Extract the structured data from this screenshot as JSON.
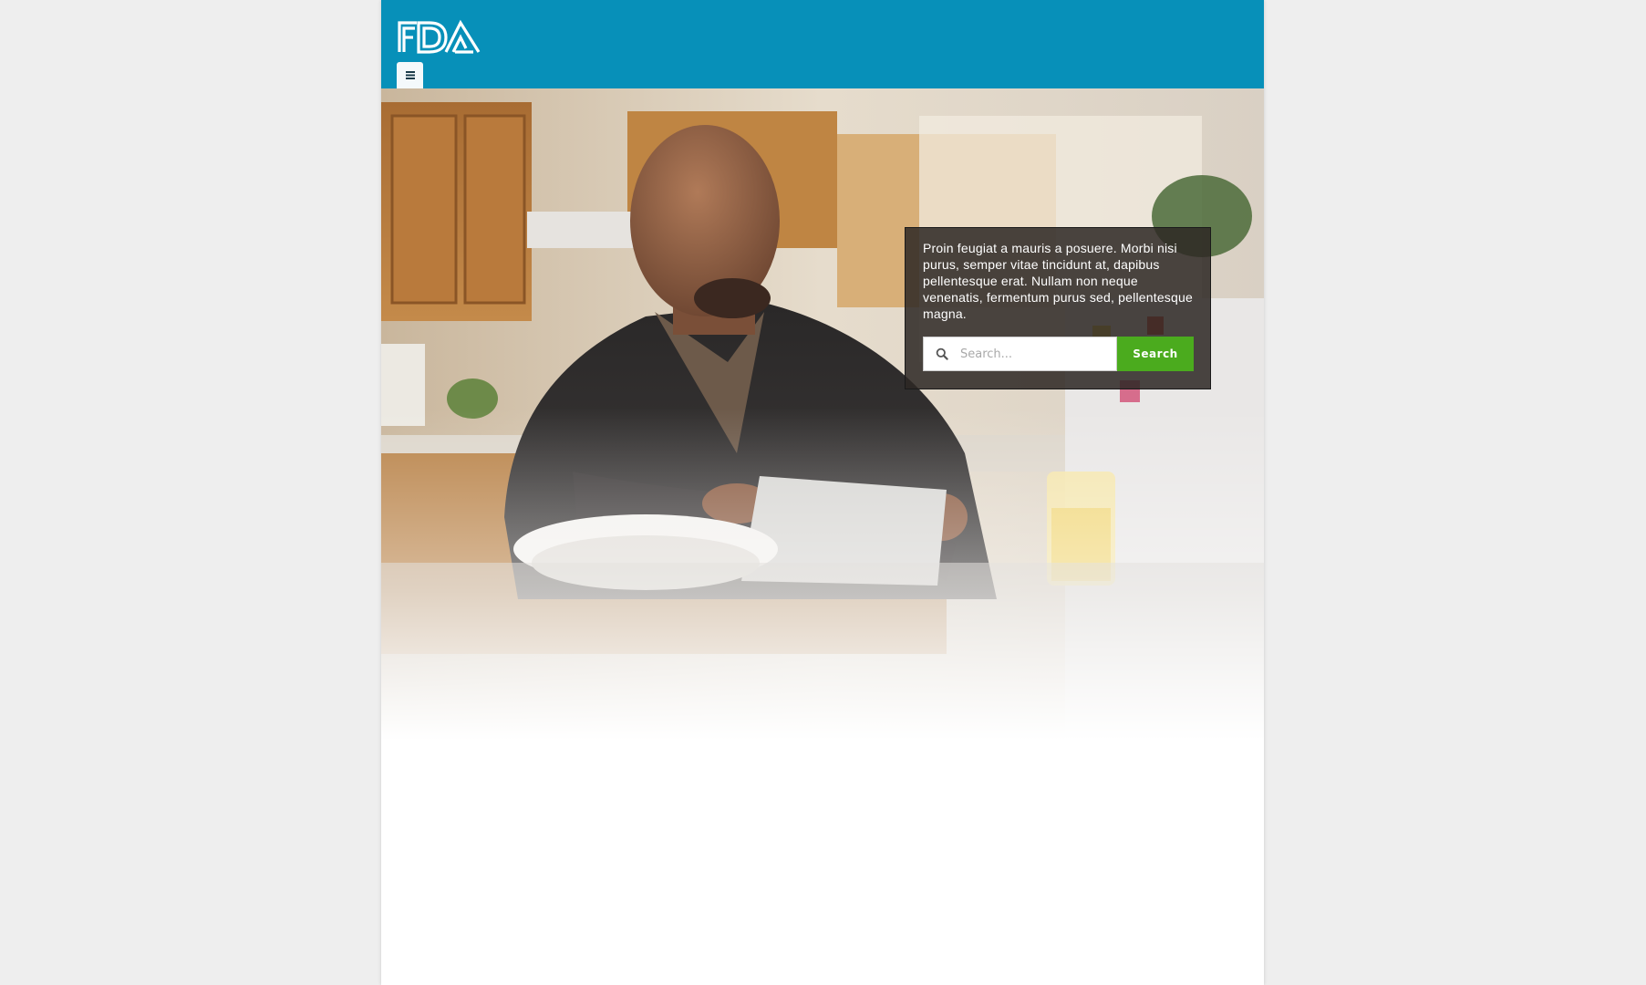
{
  "header": {
    "logo_text": "FDA",
    "menu_icon": "hamburger-menu-icon",
    "background_color": "#0790b9"
  },
  "hero": {
    "panel_text": "Proin feugiat a mauris a posuere. Morbi nisi purus, semper vitae tincidunt at, dapibus pellentesque erat. Nullam non neque venenatis, fermentum purus sed, pellentesque magna.",
    "search": {
      "placeholder": "Search...",
      "icon": "search-icon",
      "button_label": "Search",
      "button_color": "#4bab1e"
    }
  }
}
